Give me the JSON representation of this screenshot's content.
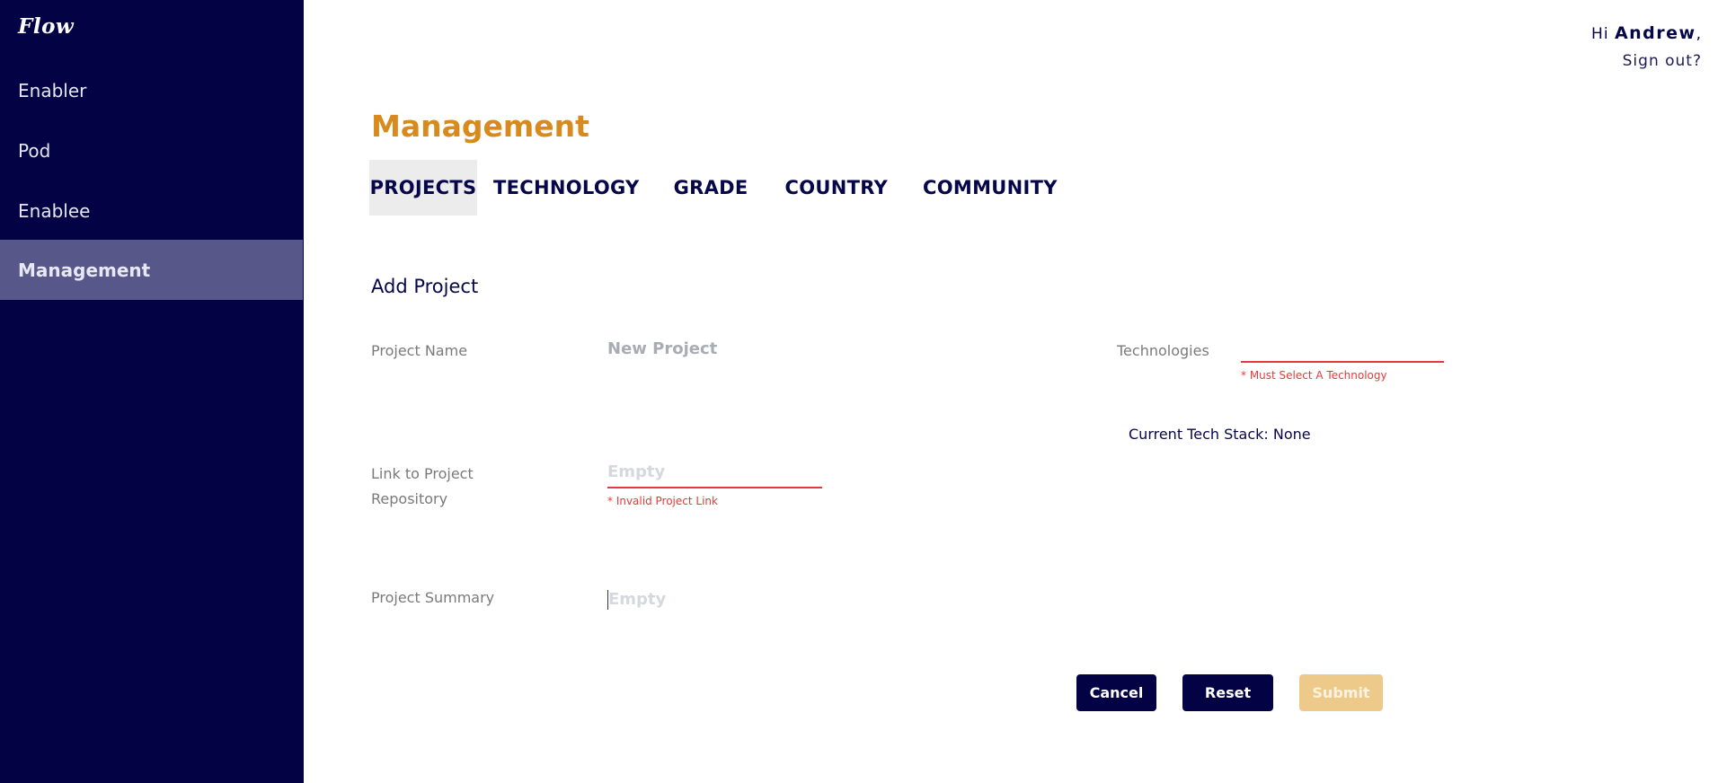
{
  "app": {
    "logo": "Flow"
  },
  "sidebar": {
    "items": [
      {
        "label": "Enabler"
      },
      {
        "label": "Pod"
      },
      {
        "label": "Enablee"
      },
      {
        "label": "Management"
      }
    ]
  },
  "user": {
    "greeting": "Hi",
    "name": "Andrew",
    "suffix": ",",
    "signout": "Sign out?"
  },
  "page": {
    "title": "Management"
  },
  "tabs": [
    {
      "label": "PROJECTS"
    },
    {
      "label": "TECHNOLOGY"
    },
    {
      "label": "GRADE"
    },
    {
      "label": "COUNTRY"
    },
    {
      "label": "COMMUNITY"
    }
  ],
  "form": {
    "title": "Add Project",
    "project_name": {
      "label": "Project Name",
      "placeholder": "New Project"
    },
    "repo_link": {
      "label_line1": "Link to Project",
      "label_line2": "Repository",
      "placeholder": "Empty",
      "error": "* Invalid Project Link"
    },
    "summary": {
      "label": "Project Summary",
      "placeholder": "Empty"
    },
    "technologies": {
      "label": "Technologies",
      "error": "* Must Select A Technology",
      "current_stack": "Current Tech Stack: None"
    }
  },
  "buttons": {
    "cancel": "Cancel",
    "reset": "Reset",
    "submit": "Submit"
  },
  "colors": {
    "sidebar": "#020245",
    "accent": "#d98a1d",
    "error": "#e8383c",
    "active_nav": "#57578a"
  }
}
